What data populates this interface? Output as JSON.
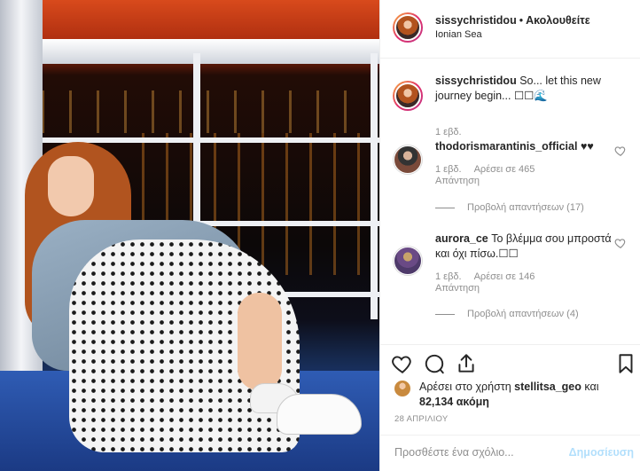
{
  "post": {
    "username": "sissychristidou",
    "separator": "•",
    "follow_label": "Ακολουθείτε",
    "location": "Ionian Sea"
  },
  "caption": {
    "username": "sissychristidou",
    "text": "So... let this new journey begin... ☐☐",
    "wave": "🌊",
    "time": "1 εβδ."
  },
  "comments": [
    {
      "username": "thodorismarantinis_official",
      "text": "♥♥",
      "time": "1 εβδ.",
      "likes": "Αρέσει σε 465",
      "reply": "Απάντηση",
      "view_replies": "Προβολή απαντήσεων (17)"
    },
    {
      "username": "aurora_ce",
      "text": "Το βλέμμα σου μπροστά και όχι πίσω.☐☐",
      "time": "1 εβδ.",
      "likes": "Αρέσει σε 146",
      "reply": "Απάντηση",
      "view_replies": "Προβολή απαντήσεων (4)"
    }
  ],
  "likes": {
    "prefix": "Αρέσει στο χρήστη",
    "user": "stellitsa_geo",
    "mid": "και",
    "count": "82,134 ακόμη"
  },
  "date": "28 ΑΠΡΙΛΙΟΥ",
  "add_comment": {
    "placeholder": "Προσθέστε ένα σχόλιο...",
    "post_label": "Δημοσίευση"
  },
  "colors": {
    "text": "#262626",
    "muted": "#8e8e8e",
    "post_disabled": "#b2dffc",
    "border": "#efefef"
  },
  "icons": [
    "heart-icon",
    "comment-icon",
    "share-icon",
    "bookmark-icon"
  ]
}
